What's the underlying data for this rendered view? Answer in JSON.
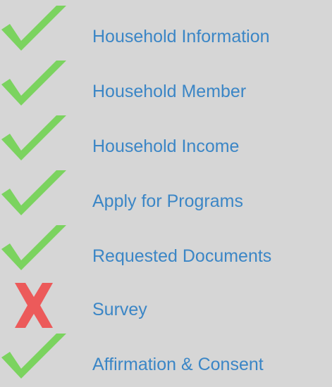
{
  "colors": {
    "background": "#d6d6d6",
    "link": "#3b86c6",
    "check": "#7bd35f",
    "cross": "#ec5a5a"
  },
  "steps": [
    {
      "label": "Household Information",
      "status": "complete",
      "icon": "check-icon"
    },
    {
      "label": "Household Member",
      "status": "complete",
      "icon": "check-icon"
    },
    {
      "label": "Household Income",
      "status": "complete",
      "icon": "check-icon"
    },
    {
      "label": "Apply for Programs",
      "status": "complete",
      "icon": "check-icon"
    },
    {
      "label": "Requested Documents",
      "status": "complete",
      "icon": "check-icon"
    },
    {
      "label": "Survey",
      "status": "incomplete",
      "icon": "cross-icon"
    },
    {
      "label": "Affirmation & Consent",
      "status": "complete",
      "icon": "check-icon"
    }
  ]
}
